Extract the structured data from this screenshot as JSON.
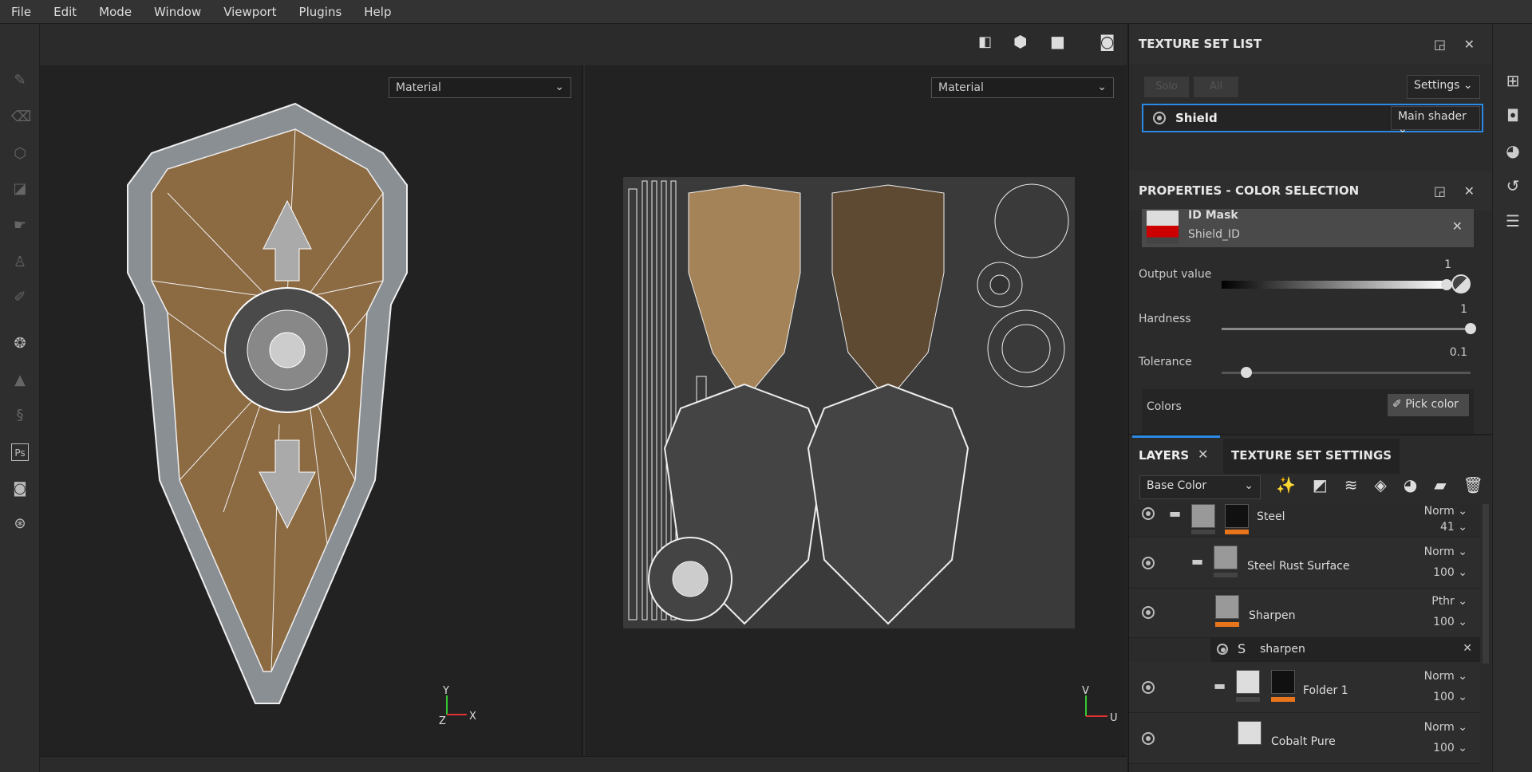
{
  "menu": [
    "File",
    "Edit",
    "Mode",
    "Window",
    "Viewport",
    "Plugins",
    "Help"
  ],
  "viewport": {
    "left_material": "Material",
    "right_material": "Material",
    "axis_3d": {
      "y": "Y",
      "z": "Z",
      "x": "X"
    },
    "axis_uv": {
      "v": "V",
      "u": "U"
    }
  },
  "texture_set_list": {
    "title": "TEXTURE SET LIST",
    "solo": "Solo",
    "all": "All",
    "settings": "Settings",
    "set_name": "Shield",
    "shader": "Main shader"
  },
  "properties": {
    "title": "PROPERTIES - COLOR SELECTION",
    "mask_name": "ID Mask",
    "mask_map": "Shield_ID",
    "output_label": "Output value",
    "output_value": "1",
    "output_fraction": 1,
    "hardness_label": "Hardness",
    "hardness_value": "1",
    "hardness_fraction": 1,
    "tolerance_label": "Tolerance",
    "tolerance_value": "0.1",
    "tolerance_fraction": 0.1,
    "colors_label": "Colors",
    "pick_color": "Pick color"
  },
  "layers_panel": {
    "tab_layers": "LAYERS",
    "tab_settings": "TEXTURE SET SETTINGS",
    "channel": "Base Color",
    "layers": [
      {
        "name": "Steel",
        "blend": "Norm",
        "opacity": "41"
      },
      {
        "name": "Steel Rust Surface",
        "blend": "Norm",
        "opacity": "100"
      },
      {
        "name": "Sharpen",
        "blend": "Pthr",
        "opacity": "100"
      },
      {
        "name": "sharpen"
      },
      {
        "name": "Folder 1",
        "blend": "Norm",
        "opacity": "100"
      },
      {
        "name": "Cobalt Pure",
        "blend": "Norm",
        "opacity": "100"
      }
    ]
  },
  "colors": {
    "accent": "#2a8ae6",
    "mask_orange": "#e8741c"
  }
}
